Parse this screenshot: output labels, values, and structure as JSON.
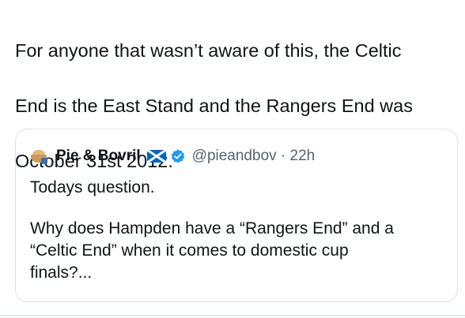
{
  "tweet": {
    "text_lines": [
      "For anyone that wasn’t aware of this, the Celtic",
      "End is the East Stand and the Rangers End was",
      "October 31st 2012."
    ]
  },
  "quoted_tweet": {
    "avatar_icon": "pie-and-mug-avatar-icon",
    "display_name": "Pie & Bovril",
    "flag_icon": "scotland-flag-icon",
    "verified_icon": "verified-badge-icon",
    "verified_color": "#1d9bf0",
    "handle": "@pieandbov",
    "separator": "·",
    "time": "22h",
    "body_line_1": "Todays question.",
    "body_para_2_lines": [
      "Why does Hampden have a “Rangers End” and a",
      "“Celtic End” when it comes to domestic cup",
      "finals?..."
    ]
  },
  "colors": {
    "text_primary": "#0f1419",
    "text_secondary": "#536471",
    "border": "#dfe3e6",
    "flag_blue": "#0065bd"
  }
}
